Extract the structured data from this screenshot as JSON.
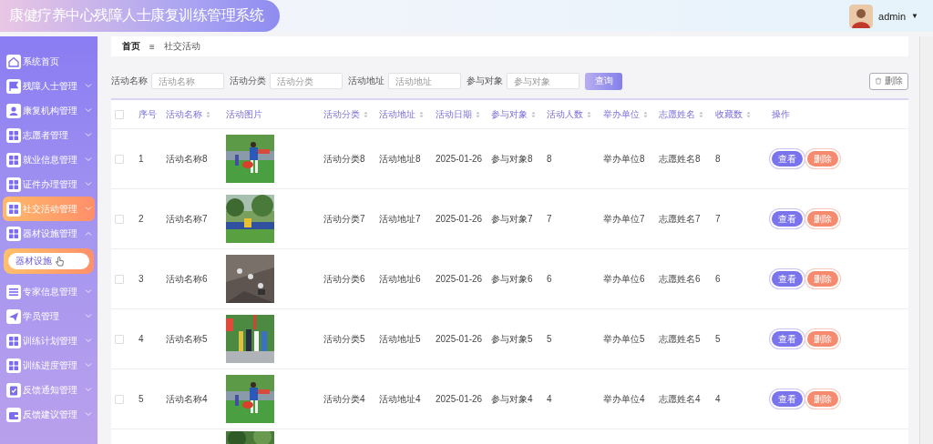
{
  "header": {
    "title": "康健疗养中心残障人士康复训练管理系统",
    "user": "admin",
    "menu_caret": "▼"
  },
  "sidebar": {
    "items": [
      {
        "label": "系统首页",
        "selected": false
      },
      {
        "label": "残障人士管理",
        "selected": false,
        "expanded": false
      },
      {
        "label": "康复机构管理",
        "selected": false,
        "expanded": false
      },
      {
        "label": "志愿者管理",
        "selected": false,
        "expanded": false
      },
      {
        "label": "就业信息管理",
        "selected": false,
        "expanded": false
      },
      {
        "label": "证件办理管理",
        "selected": false,
        "expanded": false
      },
      {
        "label": "社交活动管理",
        "selected": true,
        "expanded": false
      },
      {
        "label": "器材设施管理",
        "selected": false,
        "expanded": true,
        "children": [
          {
            "label": "器材设施",
            "selected": true
          }
        ]
      },
      {
        "label": "专家信息管理",
        "selected": false,
        "expanded": false
      },
      {
        "label": "学员管理",
        "selected": false,
        "expanded": false
      },
      {
        "label": "训练计划管理",
        "selected": false,
        "expanded": false
      },
      {
        "label": "训练进度管理",
        "selected": false,
        "expanded": false
      },
      {
        "label": "反馈通知管理",
        "selected": false,
        "expanded": false
      },
      {
        "label": "反馈建议管理",
        "selected": false,
        "expanded": false
      }
    ]
  },
  "breadcrumb": {
    "home": "首页",
    "separator": "≡",
    "current": "社交活动"
  },
  "search": {
    "fields": [
      {
        "label": "活动名称",
        "placeholder": "活动名称"
      },
      {
        "label": "活动分类",
        "placeholder": "活动分类"
      },
      {
        "label": "活动地址",
        "placeholder": "活动地址"
      },
      {
        "label": "参与对象",
        "placeholder": "参与对象"
      }
    ],
    "query_button": "查询",
    "delete_button": "删除"
  },
  "table": {
    "select_all_checked": false,
    "columns": [
      {
        "label": "序号",
        "sortable": false
      },
      {
        "label": "活动名称",
        "sortable": true
      },
      {
        "label": "活动图片",
        "sortable": false
      },
      {
        "label": "活动分类",
        "sortable": true
      },
      {
        "label": "活动地址",
        "sortable": true
      },
      {
        "label": "活动日期",
        "sortable": true
      },
      {
        "label": "参与对象",
        "sortable": true
      },
      {
        "label": "活动人数",
        "sortable": true
      },
      {
        "label": "举办单位",
        "sortable": true
      },
      {
        "label": "志愿姓名",
        "sortable": true
      },
      {
        "label": "收藏数",
        "sortable": true
      },
      {
        "label": "操作",
        "sortable": false
      }
    ],
    "rows": [
      {
        "checked": false,
        "cells": [
          "1",
          "活动名称8",
          {
            "kind": "picture"
          },
          "活动分类8",
          "活动地址8",
          "2025-01-26",
          "参与对象8",
          "8",
          "举办单位8",
          "志愿姓名8",
          "8",
          {
            "actions": [
              "查看",
              "删除"
            ]
          }
        ]
      },
      {
        "checked": false,
        "cells": [
          "2",
          "活动名称7",
          {
            "kind": "picture"
          },
          "活动分类7",
          "活动地址7",
          "2025-01-26",
          "参与对象7",
          "7",
          "举办单位7",
          "志愿姓名7",
          "7",
          {
            "actions": [
              "查看",
              "删除"
            ]
          }
        ]
      },
      {
        "checked": false,
        "cells": [
          "3",
          "活动名称6",
          {
            "kind": "picture"
          },
          "活动分类6",
          "活动地址6",
          "2025-01-26",
          "参与对象6",
          "6",
          "举办单位6",
          "志愿姓名6",
          "6",
          {
            "actions": [
              "查看",
              "删除"
            ]
          }
        ]
      },
      {
        "checked": false,
        "cells": [
          "4",
          "活动名称5",
          {
            "kind": "picture"
          },
          "活动分类5",
          "活动地址5",
          "2025-01-26",
          "参与对象5",
          "5",
          "举办单位5",
          "志愿姓名5",
          "5",
          {
            "actions": [
              "查看",
              "删除"
            ]
          }
        ]
      },
      {
        "checked": false,
        "cells": [
          "5",
          "活动名称4",
          {
            "kind": "picture"
          },
          "活动分类4",
          "活动地址4",
          "2025-01-26",
          "参与对象4",
          "4",
          "举办单位4",
          "志愿姓名4",
          "4",
          {
            "actions": [
              "查看",
              "删除"
            ]
          }
        ]
      }
    ],
    "cut_off_row": {
      "kind": "picture"
    }
  }
}
